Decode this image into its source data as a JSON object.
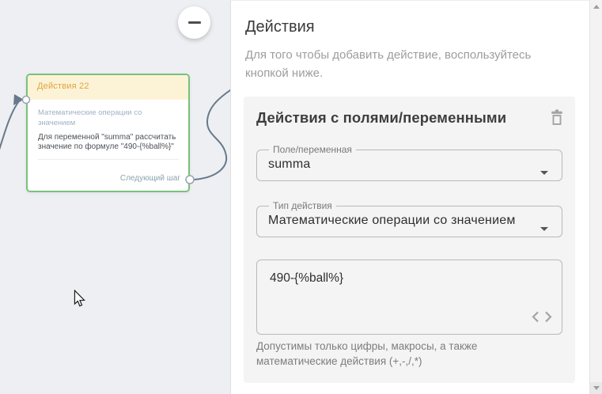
{
  "canvas": {
    "node": {
      "header": "Действия 22",
      "type": "Математические операции со значением",
      "description": "Для переменной \"summa\" рассчитать значение по формуле \"490-{%ball%}\"",
      "next_step_label": "Следующий шаг"
    },
    "icons": {
      "collapse": "minus-in-circle",
      "connector_ports": "small-white-circles",
      "cursor": "arrow-pointer"
    },
    "colors": {
      "canvas_bg": "#edeff2",
      "node_border": "#79c17c",
      "node_header_bg": "#fcf3d7",
      "node_header_text": "#e0a43e",
      "node_type_text": "#9fb1c7",
      "next_step_text": "#8ba4ae",
      "connector": "#68798c"
    }
  },
  "panel": {
    "title": "Действия",
    "subtitle": "Для того чтобы добавить действие, воспользуйтесь кнопкой ниже.",
    "action_card": {
      "title": "Действия с полями/переменными",
      "fields": [
        {
          "label": "Поле/переменная",
          "value": "summa"
        },
        {
          "label": "Тип действия",
          "value": "Математические операции со значением"
        }
      ],
      "formula": {
        "value": "490-{%ball%}"
      },
      "helper": "Допустимы только цифры, макросы, а также математические действия (+,-,/,*)",
      "icons": {
        "delete": "trash-outline",
        "dropdown": "caret-down",
        "code": "angle-brackets"
      },
      "colors": {
        "card_bg": "#f4f4f4",
        "field_border": "#b9b9b9",
        "label_text": "#7a7a7a",
        "value_text": "#2e2e2e",
        "helper_text": "#7d7d7d"
      }
    }
  },
  "scrollbar": {
    "position": "top"
  }
}
